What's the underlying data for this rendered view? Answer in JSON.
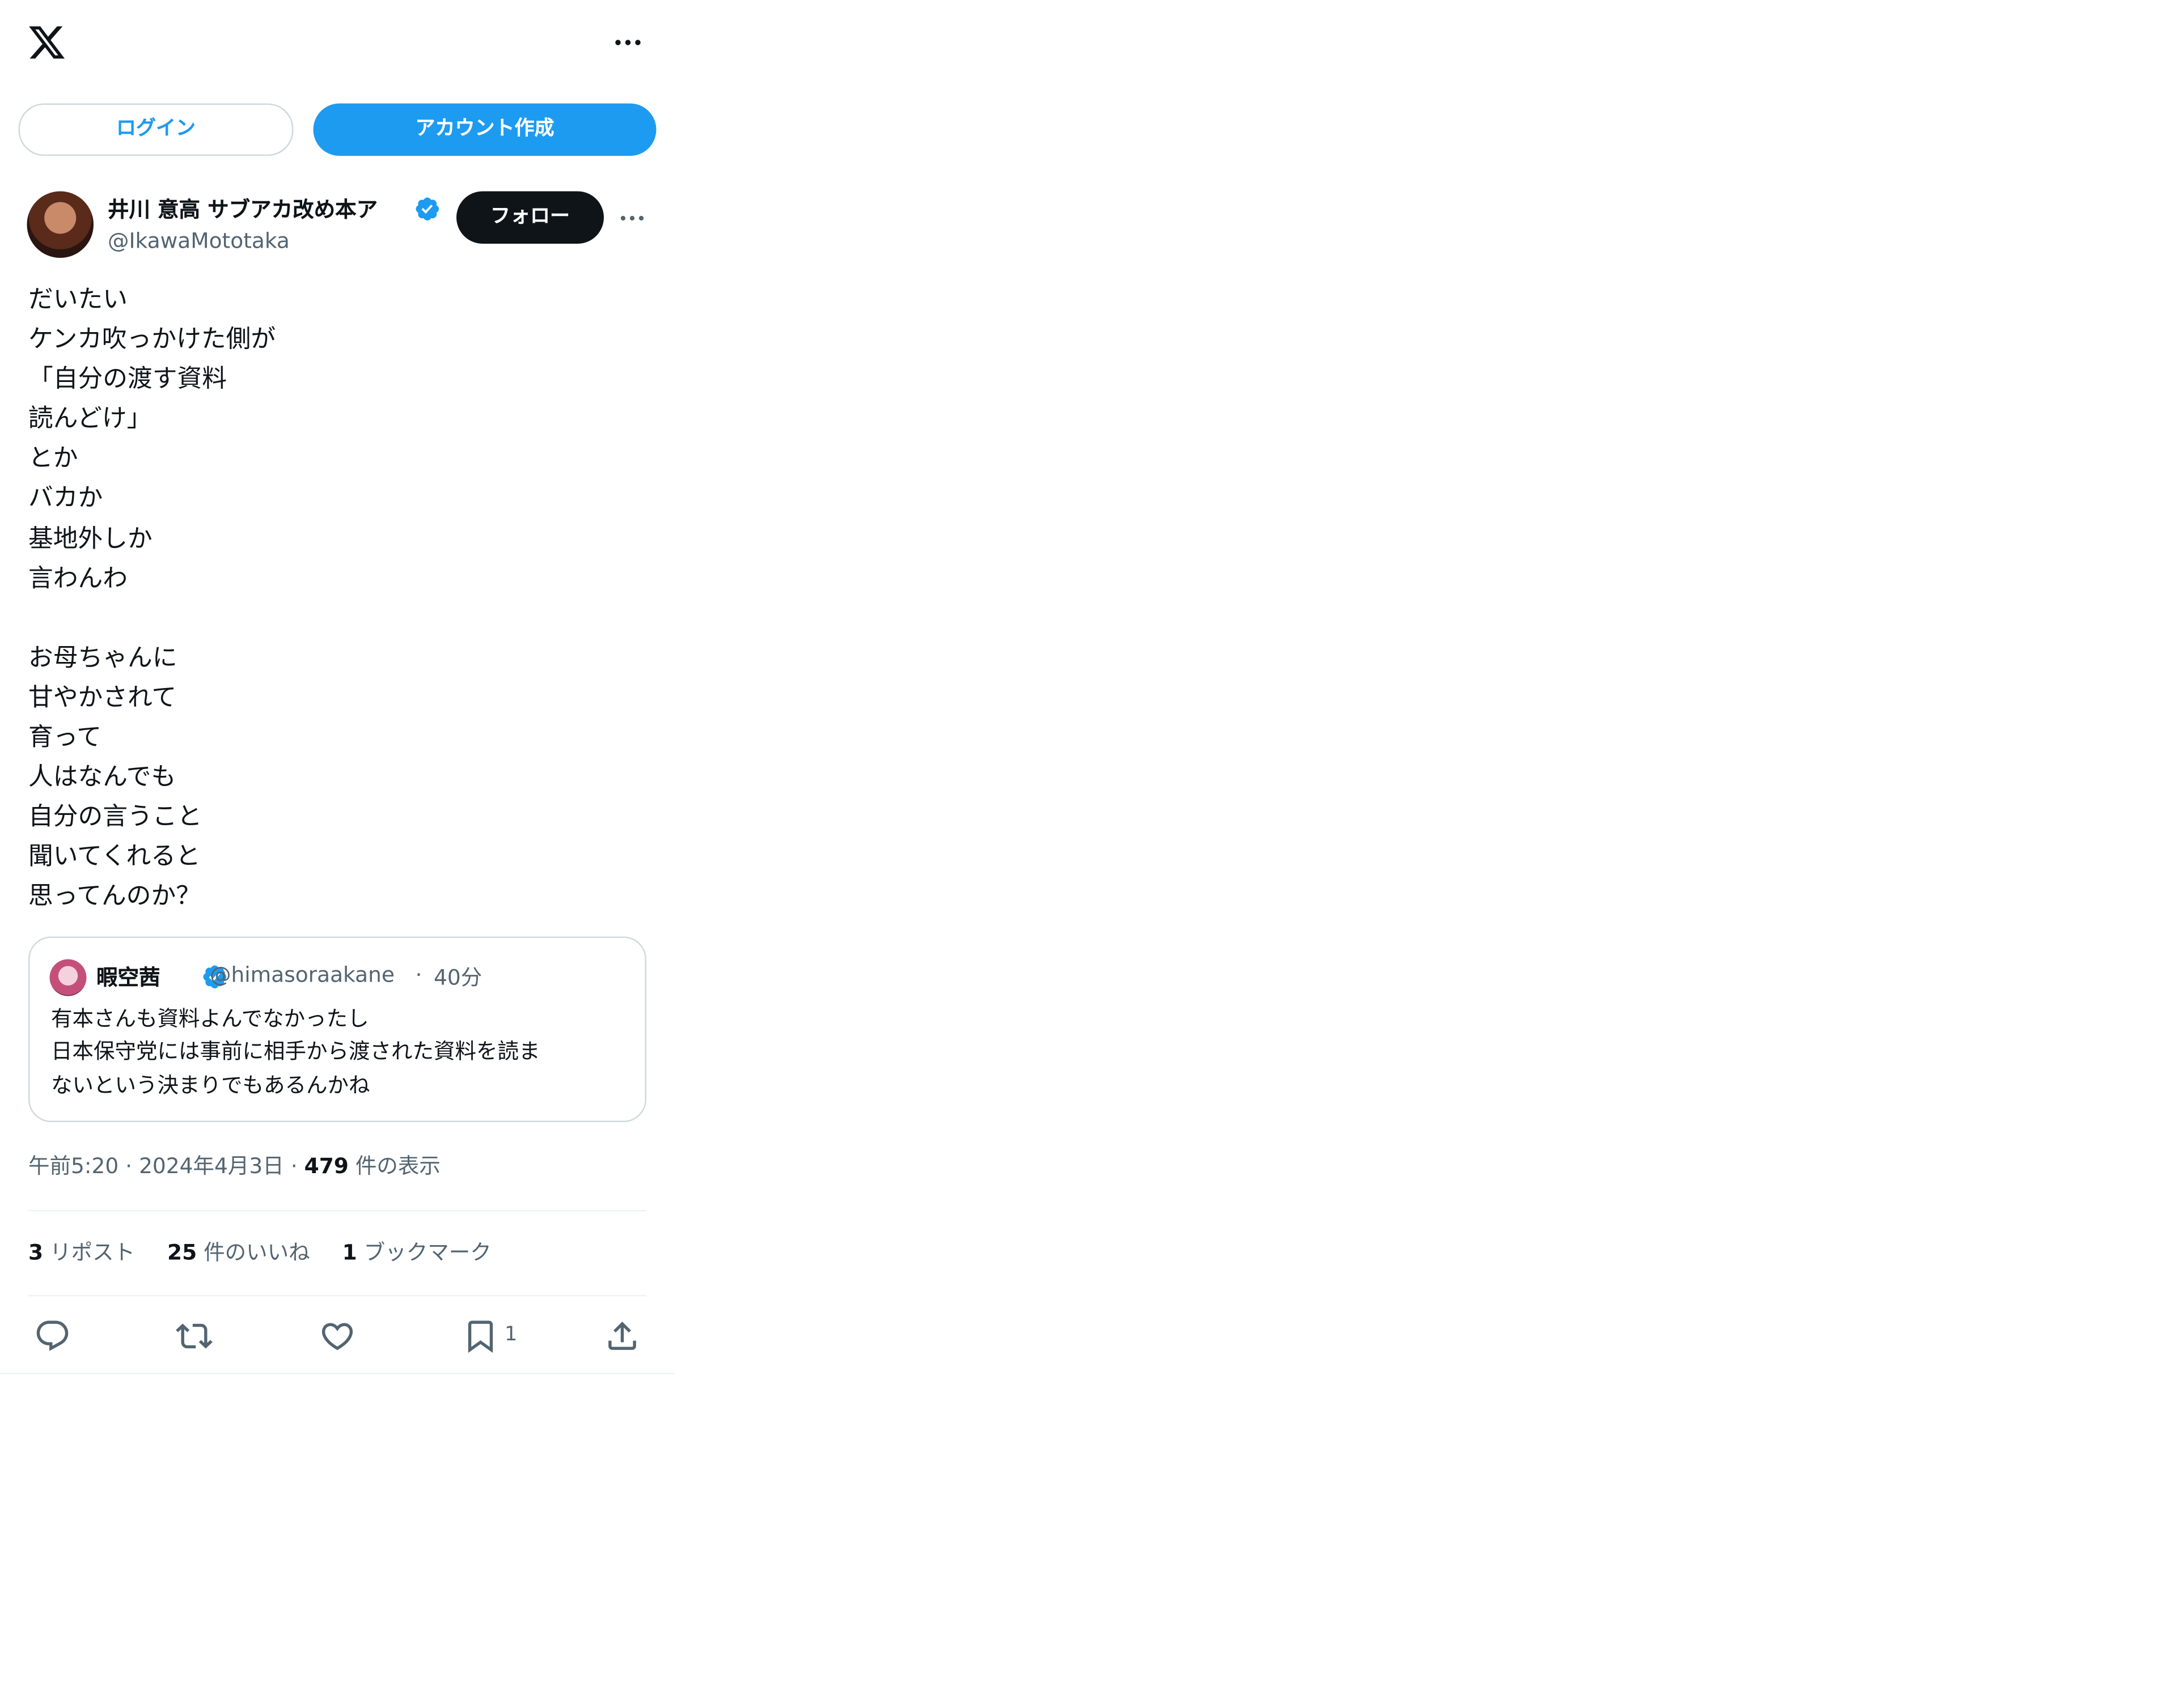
{
  "header": {
    "logo_icon": "x-logo-icon",
    "more_icon": "more-horizontal-icon"
  },
  "auth": {
    "login_label": "ログイン",
    "create_account_label": "アカウント作成"
  },
  "author": {
    "name": "井川 意高 サブアカ改め本ア",
    "handle": "@IkawaMototaka",
    "verified": true,
    "follow_label": "フォロー"
  },
  "tweet": {
    "lines": [
      "だいたい",
      "ケンカ吹っかけた側が",
      "「自分の渡す資料",
      "読んどけ」",
      "とか",
      "バカか",
      "基地外しか",
      "言わんわ",
      "",
      "お母ちゃんに",
      "甘やかされて",
      "育って",
      "人はなんでも",
      "自分の言うこと",
      "聞いてくれると",
      "思ってんのか？"
    ]
  },
  "quote": {
    "name": "暇空茜",
    "handle": "@himasoraakane",
    "separator": "·",
    "time": "40分",
    "lines": [
      "有本さんも資料よんでなかったし",
      "日本保守党には事前に相手から渡された資料を読ま",
      "ないという決まりでもあるんかね"
    ]
  },
  "meta": {
    "time": "午前5:20",
    "separator": "·",
    "date": "2024年4月3日",
    "views_count": "479",
    "views_label": "件の表示"
  },
  "stats": {
    "reposts_count": "3",
    "reposts_label": "リポスト",
    "likes_count": "25",
    "likes_label": "件のいいね",
    "bookmarks_count": "1",
    "bookmarks_label": "ブックマーク"
  },
  "actions": {
    "bookmark_count": "1"
  },
  "colors": {
    "accent": "#1d9bf0",
    "text": "#0f1419",
    "secondary": "#536471",
    "border": "#cfd9de"
  }
}
